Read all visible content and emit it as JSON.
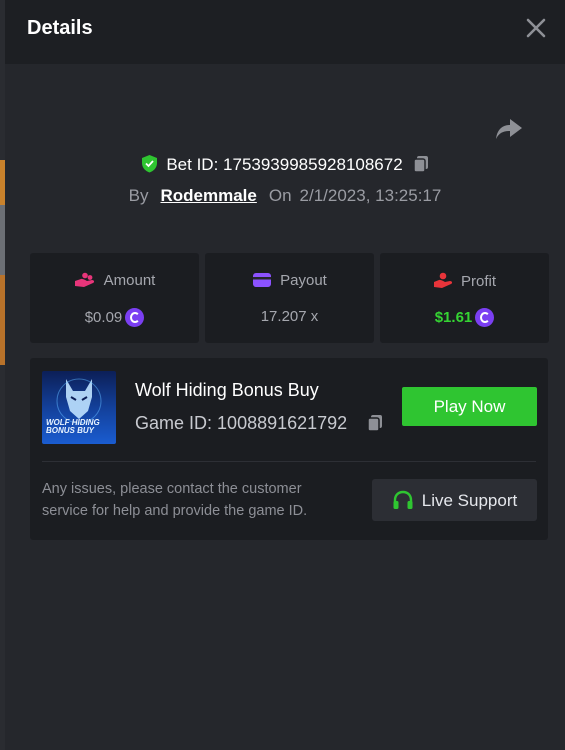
{
  "header": {
    "title": "Details"
  },
  "bet": {
    "label": "Bet ID:",
    "id": "1753939985928108672"
  },
  "meta": {
    "by_label": "By",
    "user": "Rodemmale",
    "on_label": "On",
    "datetime": "2/1/2023, 13:25:17"
  },
  "stats": [
    {
      "label": "Amount",
      "value": "$0.09",
      "icon": "hand-coins-icon"
    },
    {
      "label": "Payout",
      "value": "17.207 x",
      "icon": "wallet-icon"
    },
    {
      "label": "Profit",
      "value": "$1.61",
      "icon": "hand-profit-icon"
    }
  ],
  "game": {
    "name": "Wolf Hiding Bonus Buy",
    "id_label": "Game ID:",
    "id": "1008891621792",
    "thumb_text_1": "WOLF HIDING",
    "thumb_text_2": "BONUS BUY",
    "play_label": "Play Now"
  },
  "support": {
    "note": "Any issues, please contact the customer service for help and provide the game ID.",
    "button_label": "Live Support"
  },
  "colors": {
    "accent_green": "#2fc531",
    "profit_green": "#35d433",
    "coin_purple": "#7b3ff2",
    "amount_pink": "#e8357a",
    "payout_purple": "#8c52ff",
    "profit_red": "#e8343a"
  }
}
